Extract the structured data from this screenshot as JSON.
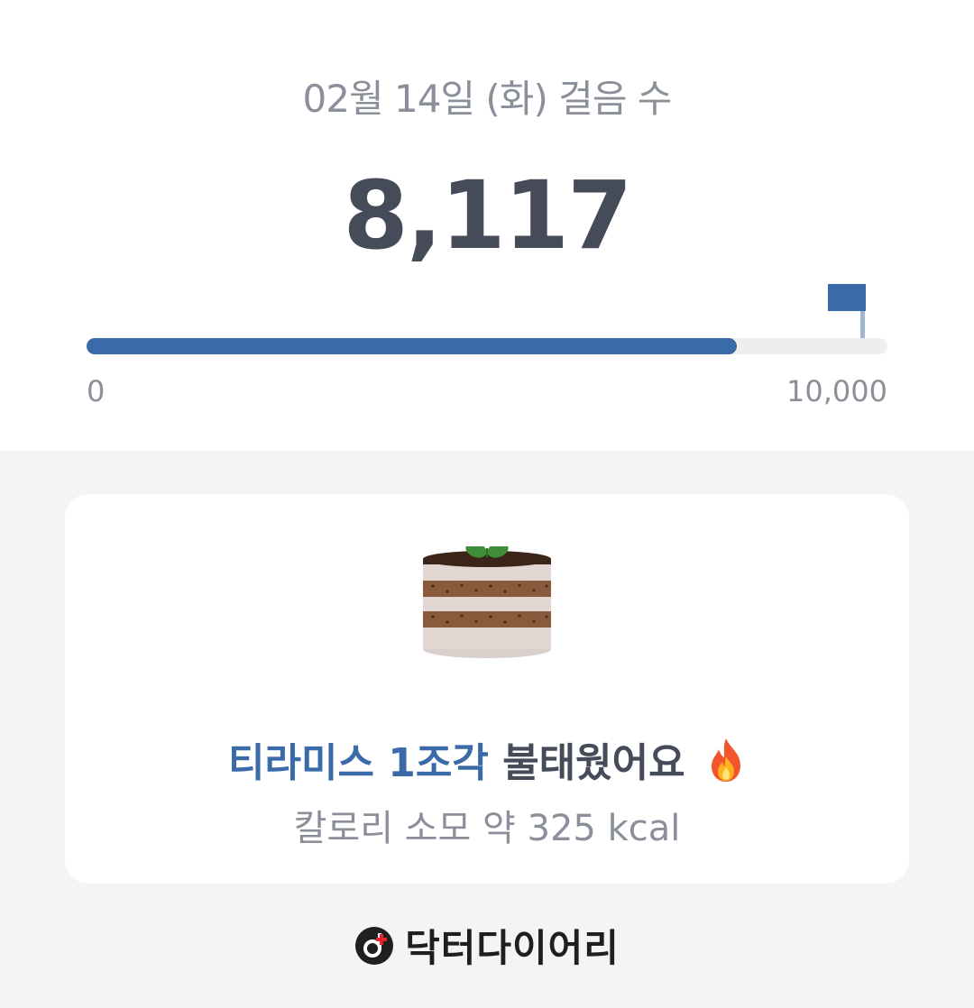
{
  "header": {
    "date_title": "02월 14일 (화) 걸음 수",
    "step_count": "8,117"
  },
  "progress": {
    "fraction": 0.8117,
    "min_label": "0",
    "max_label": "10,000",
    "fill_color": "#3a6ba8"
  },
  "achievement": {
    "icon": "tiramisu-cake-icon",
    "food_text": "티라미스 1조각",
    "burned_text": "불태웠어요",
    "emoji_icon": "fire-icon",
    "calorie_text": "칼로리 소모 약 325 kcal"
  },
  "brand": {
    "name": "닥터다이어리",
    "logo": "doctor-diary-logo-icon"
  },
  "colors": {
    "accent": "#3a6ba8",
    "text_dark": "#454b59",
    "text_muted": "#8a8f99",
    "background": "#f4f4f5"
  }
}
